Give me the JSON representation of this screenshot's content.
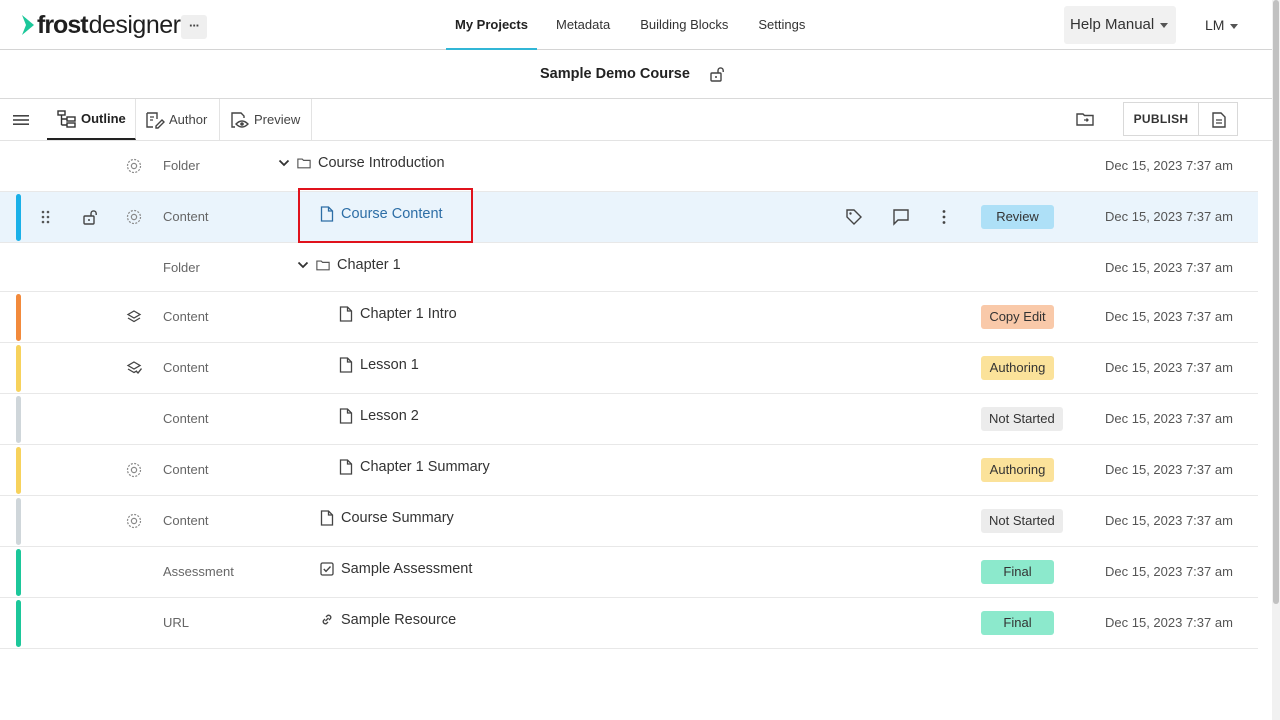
{
  "app": {
    "logo_frost": "frost",
    "logo_designer": "designer",
    "more_label": "···"
  },
  "nav": {
    "items": [
      {
        "label": "My Projects",
        "active": true
      },
      {
        "label": "Metadata"
      },
      {
        "label": "Building Blocks"
      },
      {
        "label": "Settings"
      }
    ],
    "help_label": "Help Manual",
    "user_initials": "LM"
  },
  "course": {
    "title": "Sample Demo Course"
  },
  "toolbar": {
    "outline_label": "Outline",
    "author_label": "Author",
    "preview_label": "Preview",
    "publish_label": "PUBLISH"
  },
  "colors": {
    "accent": "#31b6d6",
    "link": "#2d6ea6",
    "highlight": "#e0121c"
  },
  "rows": [
    {
      "type": "Folder",
      "title": "Course Introduction",
      "kind": "folder",
      "status_icon": "gear-badge-icon",
      "date": "Dec 15, 2023 7:37 am",
      "stripe": null,
      "badge": null
    },
    {
      "type": "Content",
      "title": "Course Content",
      "kind": "page",
      "status_icon": "gear-badge-icon",
      "date": "Dec 15, 2023 7:37 am",
      "stripe": "#1ab0e8",
      "badge": {
        "label": "Review",
        "color": "#aee0f7"
      },
      "selected": true
    },
    {
      "type": "Folder",
      "title": "Chapter 1",
      "kind": "folder",
      "status_icon": null,
      "date": "Dec 15, 2023 7:37 am",
      "stripe": null,
      "badge": null
    },
    {
      "type": "Content",
      "title": "Chapter 1 Intro",
      "kind": "page",
      "status_icon": "layers-icon",
      "date": "Dec 15, 2023 7:37 am",
      "stripe": "#f28a3c",
      "badge": {
        "label": "Copy Edit",
        "color": "#f9c9a9"
      }
    },
    {
      "type": "Content",
      "title": "Lesson 1",
      "kind": "page",
      "status_icon": "layers-check-icon",
      "date": "Dec 15, 2023 7:37 am",
      "stripe": "#f7d25c",
      "badge": {
        "label": "Authoring",
        "color": "#fbe29a"
      }
    },
    {
      "type": "Content",
      "title": "Lesson 2",
      "kind": "page",
      "status_icon": null,
      "date": "Dec 15, 2023 7:37 am",
      "stripe": "#cfd6da",
      "badge": {
        "label": "Not Started",
        "color": "#ececec"
      }
    },
    {
      "type": "Content",
      "title": "Chapter 1 Summary",
      "kind": "page",
      "status_icon": "gear-badge-icon",
      "date": "Dec 15, 2023 7:37 am",
      "stripe": "#f7d25c",
      "badge": {
        "label": "Authoring",
        "color": "#fbe29a"
      }
    },
    {
      "type": "Content",
      "title": "Course Summary",
      "kind": "page",
      "status_icon": "gear-badge-icon",
      "date": "Dec 15, 2023 7:37 am",
      "stripe": "#cfd6da",
      "badge": {
        "label": "Not Started",
        "color": "#ececec"
      }
    },
    {
      "type": "Assessment",
      "title": "Sample Assessment",
      "kind": "assessment",
      "status_icon": null,
      "date": "Dec 15, 2023 7:37 am",
      "stripe": "#1cc79a",
      "badge": {
        "label": "Final",
        "color": "#8ce9cc"
      }
    },
    {
      "type": "URL",
      "title": "Sample Resource",
      "kind": "url",
      "status_icon": null,
      "date": "Dec 15, 2023 7:37 am",
      "stripe": "#1cc79a",
      "badge": {
        "label": "Final",
        "color": "#8ce9cc"
      }
    }
  ]
}
